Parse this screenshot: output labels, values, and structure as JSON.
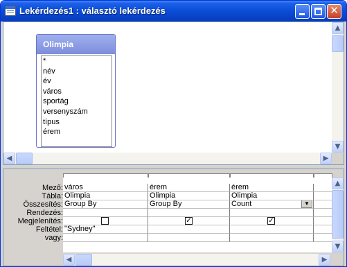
{
  "window": {
    "title": "Lekérdezés1 : választó lekérdezés"
  },
  "design": {
    "table": {
      "name": "Olimpia",
      "fields": [
        "*",
        "név",
        "év",
        "város",
        "sportág",
        "versenyszám",
        "típus",
        "érem"
      ]
    }
  },
  "grid": {
    "row_labels": [
      "Mező:",
      "Tábla:",
      "Összesítés:",
      "Rendezés:",
      "Megjelenítés:",
      "Feltétel:",
      "vagy:"
    ],
    "columns": [
      {
        "field": "város",
        "table": "Olimpia",
        "total": "Group By",
        "sort": "",
        "show": true,
        "criteria": "\"Sydney\"",
        "or": ""
      },
      {
        "field": "érem",
        "table": "Olimpia",
        "total": "Group By",
        "sort": "",
        "show": true,
        "criteria": "",
        "or": ""
      },
      {
        "field": "érem",
        "table": "Olimpia",
        "total": "Count",
        "sort": "",
        "show": true,
        "criteria": "",
        "or": ""
      }
    ]
  },
  "icons": {
    "minimize": "minimize-icon",
    "maximize": "maximize-icon",
    "close": "close-icon",
    "scroll_up": "arrow-up-icon",
    "scroll_down": "arrow-down-icon",
    "scroll_left": "arrow-left-icon",
    "scroll_right": "arrow-right-icon",
    "dropdown": "chevron-down-icon",
    "check": "checkmark-icon"
  },
  "colors": {
    "titlebar": "#0a4fd8",
    "table_header": "#8a9ae4",
    "pane_bg": "#d6d3ce"
  }
}
